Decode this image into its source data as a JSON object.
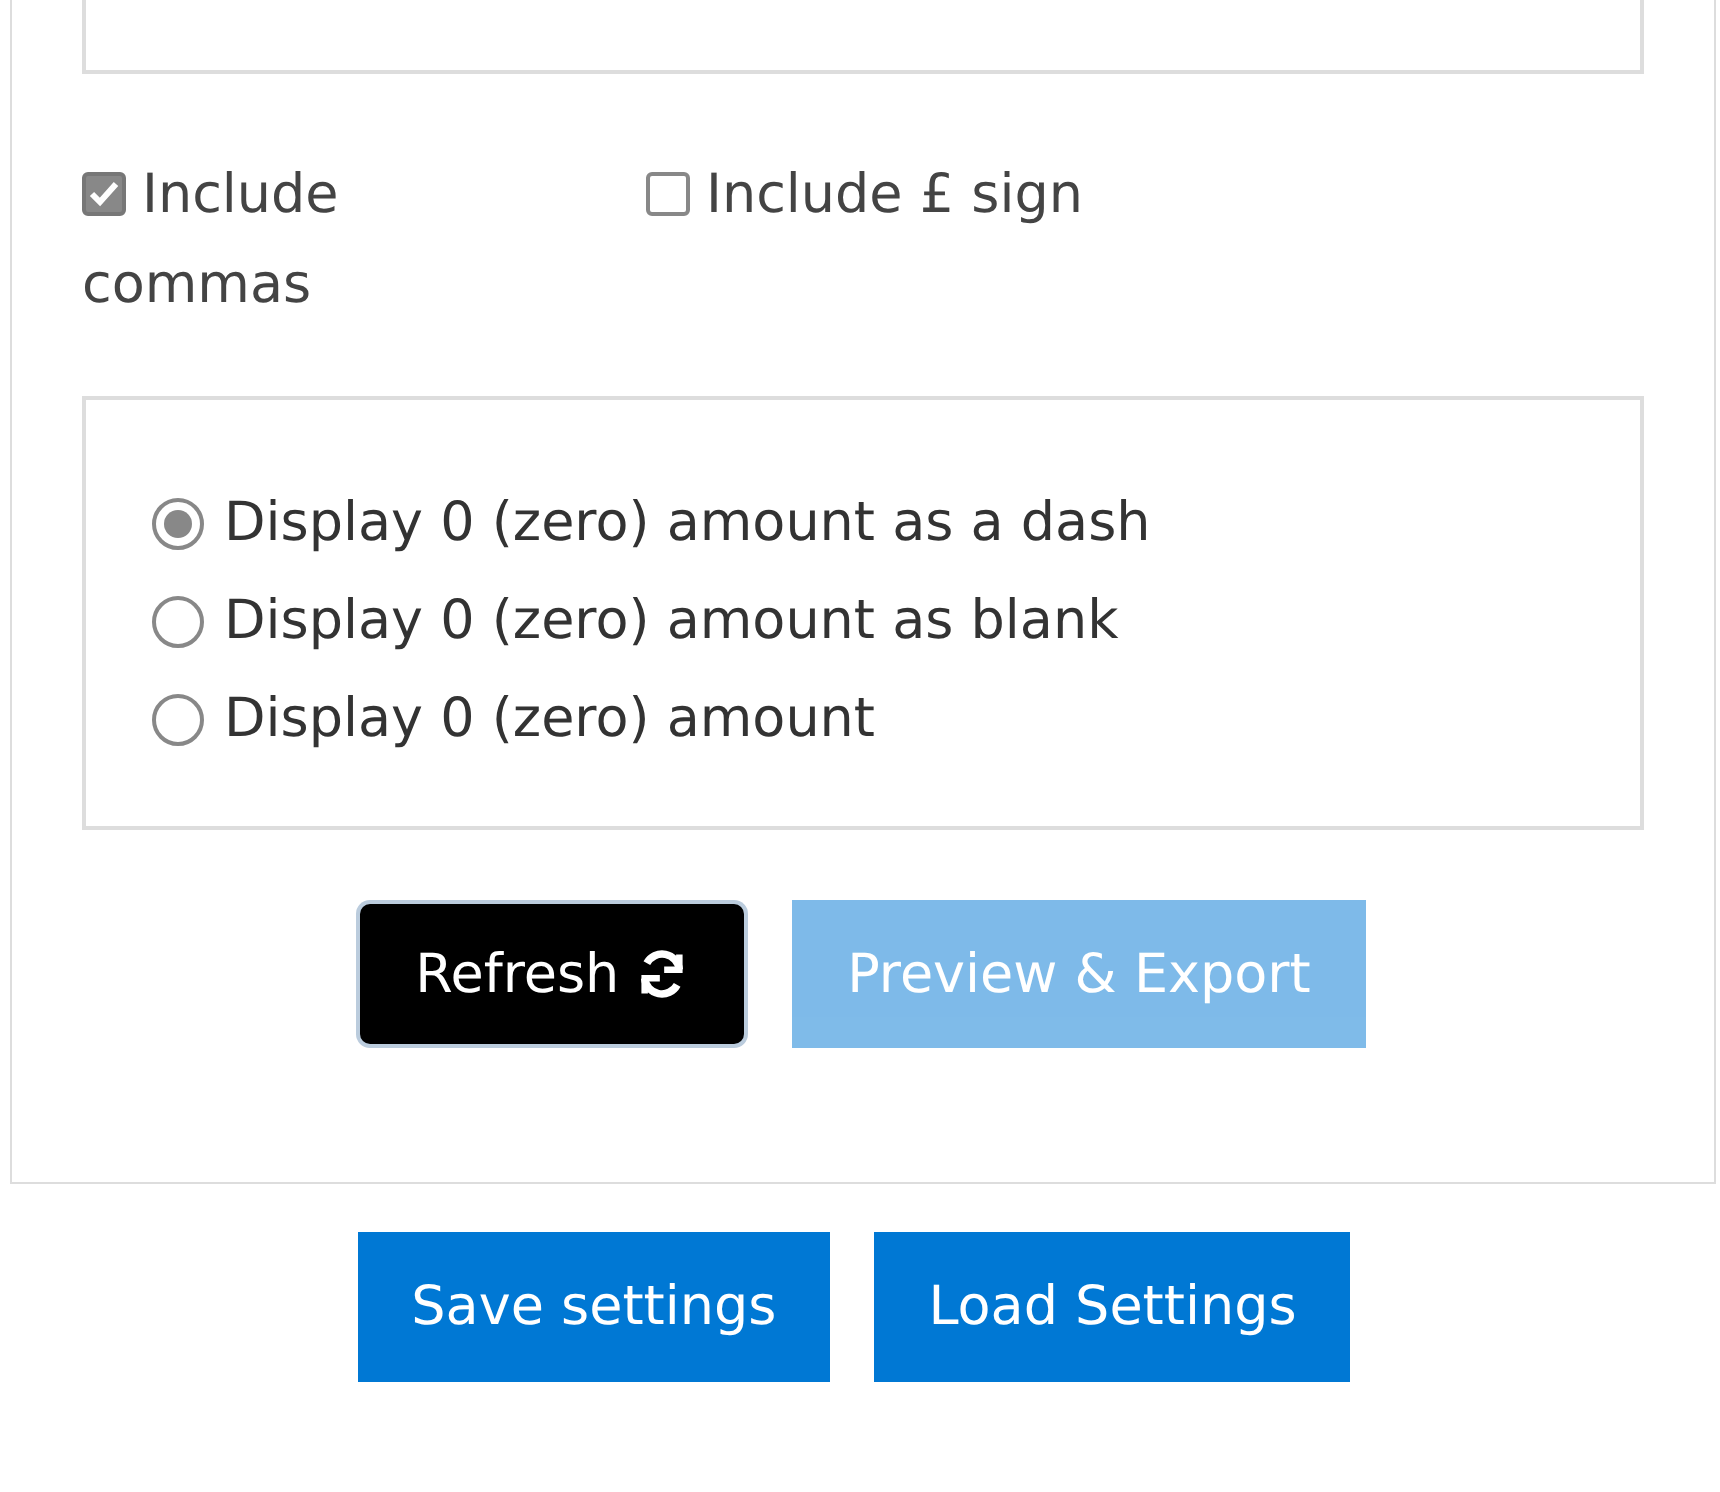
{
  "options": [
    {
      "label": "Include commas",
      "checked": true
    },
    {
      "label": "Include £ sign",
      "checked": false
    }
  ],
  "zero_display": [
    {
      "label": "Display 0 (zero) amount as a dash",
      "selected": true
    },
    {
      "label": "Display 0 (zero) amount as blank",
      "selected": false
    },
    {
      "label": "Display 0 (zero) amount",
      "selected": false
    }
  ],
  "actions": [
    {
      "label": "Refresh",
      "kind": "refresh",
      "disabled": false
    },
    {
      "label": "Preview & Export",
      "kind": "primary",
      "disabled": true
    }
  ],
  "footer_buttons": [
    "Save settings",
    "Load Settings"
  ]
}
